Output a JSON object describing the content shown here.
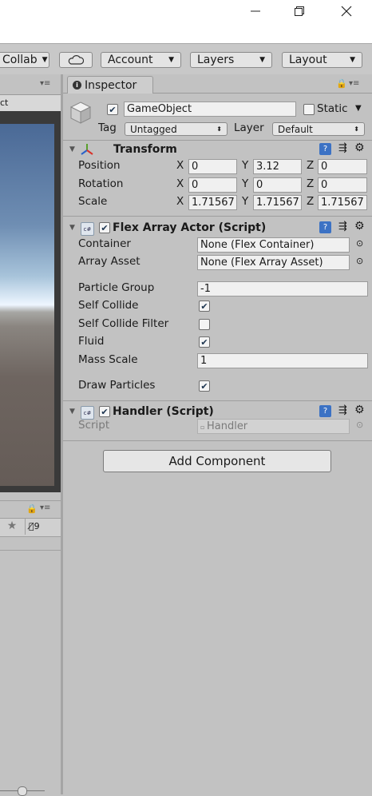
{
  "window": {
    "minimize": "—",
    "restore": "❐",
    "close": "✕"
  },
  "toolbar": {
    "collab": "Collab",
    "account": "Account",
    "layers": "Layers",
    "layout": "Layout"
  },
  "left": {
    "scene_tab_text": "ct",
    "hierarchy_count": "9"
  },
  "inspector": {
    "tab_label": "Inspector",
    "object": {
      "name": "GameObject",
      "static_label": "Static",
      "tag_label": "Tag",
      "tag_value": "Untagged",
      "layer_label": "Layer",
      "layer_value": "Default"
    },
    "transform": {
      "title": "Transform",
      "position": {
        "label": "Position",
        "x": "0",
        "y": "3.12",
        "z": "0"
      },
      "rotation": {
        "label": "Rotation",
        "x": "0",
        "y": "0",
        "z": "0"
      },
      "scale": {
        "label": "Scale",
        "x": "1.71567",
        "y": "1.71567",
        "z": "1.71567"
      },
      "axis_x": "X",
      "axis_y": "Y",
      "axis_z": "Z"
    },
    "flex": {
      "title": "Flex Array Actor (Script)",
      "container_label": "Container",
      "container_value": "None (Flex Container)",
      "array_asset_label": "Array Asset",
      "array_asset_value": "None (Flex Array Asset)",
      "particle_group_label": "Particle Group",
      "particle_group_value": "-1",
      "self_collide_label": "Self Collide",
      "self_collide_filter_label": "Self Collide Filter",
      "fluid_label": "Fluid",
      "mass_scale_label": "Mass Scale",
      "mass_scale_value": "1",
      "draw_particles_label": "Draw Particles"
    },
    "handler": {
      "title": "Handler (Script)",
      "script_label": "Script",
      "script_value": "Handler"
    },
    "add_component": "Add Component"
  }
}
